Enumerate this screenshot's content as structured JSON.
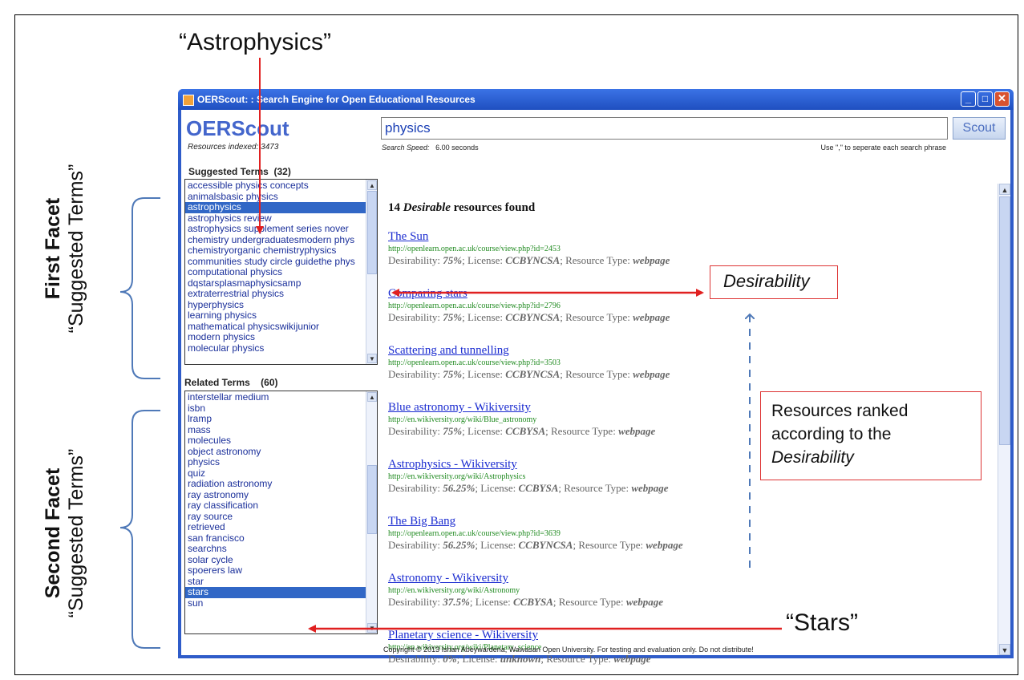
{
  "annotations": {
    "astrophysics_callout": "“Astrophysics”",
    "stars_callout": "“Stars”",
    "desirability_box": "Desirability",
    "ranked_box": [
      "Resources ranked",
      "according to the",
      "Desirability"
    ],
    "first_facet_bold": "First Facet",
    "first_facet_sub": "“Suggested Terms”",
    "second_facet_bold": "Second Facet",
    "second_facet_sub": "“Suggested Terms”"
  },
  "window": {
    "title": "OERScout: : Search Engine for Open Educational Resources",
    "controls": {
      "minimize": "_",
      "maximize": "□",
      "close": "✕"
    }
  },
  "app": {
    "brand": "OERScout",
    "resources_indexed": "Resources indexed: 3473"
  },
  "search": {
    "query": "physics",
    "button_label": "Scout",
    "speed_label": "Search Speed:",
    "speed_value": "6.00 seconds",
    "hint": "Use \",\" to seperate each search phrase"
  },
  "suggested_terms": {
    "label": "Suggested Terms",
    "count": "(32)",
    "items": [
      "accessible physics concepts",
      "animalsbasic physics",
      "astrophysics",
      "astrophysics review",
      "astrophysics supplement series nover",
      "chemistry undergraduatesmodern phys",
      "chemistryorganic chemistryphysics",
      "communities study circle guidethe phys",
      "computational physics",
      "dqstarsplasmaphysicsamp",
      "extraterrestrial physics",
      "hyperphysics",
      "learning physics",
      "mathematical physicswikijunior",
      "modern physics",
      "molecular physics"
    ],
    "selected": "astrophysics"
  },
  "related_terms": {
    "label": "Related Terms",
    "count": "(60)",
    "items": [
      "interstellar medium",
      "isbn",
      "lramp",
      "mass",
      "molecules",
      "object astronomy",
      "physics",
      "quiz",
      "radiation astronomy",
      "ray astronomy",
      "ray classification",
      "ray source",
      "retrieved",
      "san francisco",
      "searchns",
      "solar cycle",
      "spoerers law",
      "star",
      "stars",
      "sun"
    ],
    "selected": "stars"
  },
  "results": {
    "count": "14",
    "emphasis": "Desirable",
    "suffix": "resources found",
    "desirability_label": "Desirability:",
    "license_label": "License:",
    "type_label": "Resource Type:",
    "items": [
      {
        "title": "The Sun",
        "url": "http://openlearn.open.ac.uk/course/view.php?id=2453",
        "desirability": "75%",
        "license": "CCBYNCSA",
        "type": "webpage"
      },
      {
        "title": "Comparing stars",
        "url": "http://openlearn.open.ac.uk/course/view.php?id=2796",
        "desirability": "75%",
        "license": "CCBYNCSA",
        "type": "webpage"
      },
      {
        "title": "Scattering and tunnelling",
        "url": "http://openlearn.open.ac.uk/course/view.php?id=3503",
        "desirability": "75%",
        "license": "CCBYNCSA",
        "type": "webpage"
      },
      {
        "title": "Blue astronomy - Wikiversity",
        "url": "http://en.wikiversity.org/wiki/Blue_astronomy",
        "desirability": "75%",
        "license": "CCBYSA",
        "type": "webpage"
      },
      {
        "title": "Astrophysics - Wikiversity",
        "url": "http://en.wikiversity.org/wiki/Astrophysics",
        "desirability": "56.25%",
        "license": "CCBYSA",
        "type": "webpage"
      },
      {
        "title": "The Big Bang",
        "url": "http://openlearn.open.ac.uk/course/view.php?id=3639",
        "desirability": "56.25%",
        "license": "CCBYNCSA",
        "type": "webpage"
      },
      {
        "title": "Astronomy - Wikiversity",
        "url": "http://en.wikiversity.org/wiki/Astronomy",
        "desirability": "37.5%",
        "license": "CCBYSA",
        "type": "webpage"
      },
      {
        "title": "Planetary science - Wikiversity",
        "url": "http://en.wikiversity.org/wiki/Planetary_science",
        "desirability": "0%",
        "license": "unknown",
        "type": "webpage"
      }
    ]
  },
  "footer": {
    "copyright": "Copyright © 2013 Ishan Abeywardena, Wawasan Open University. For testing and evaluation only. Do not distribute!"
  },
  "colors": {
    "annotation_arrow": "#e02020",
    "dashed_arrow": "#4f79b8",
    "title_bar": "#2f5cc9",
    "link": "#1a2bd0",
    "url": "#1f8a1f",
    "selection": "#3167c6"
  }
}
